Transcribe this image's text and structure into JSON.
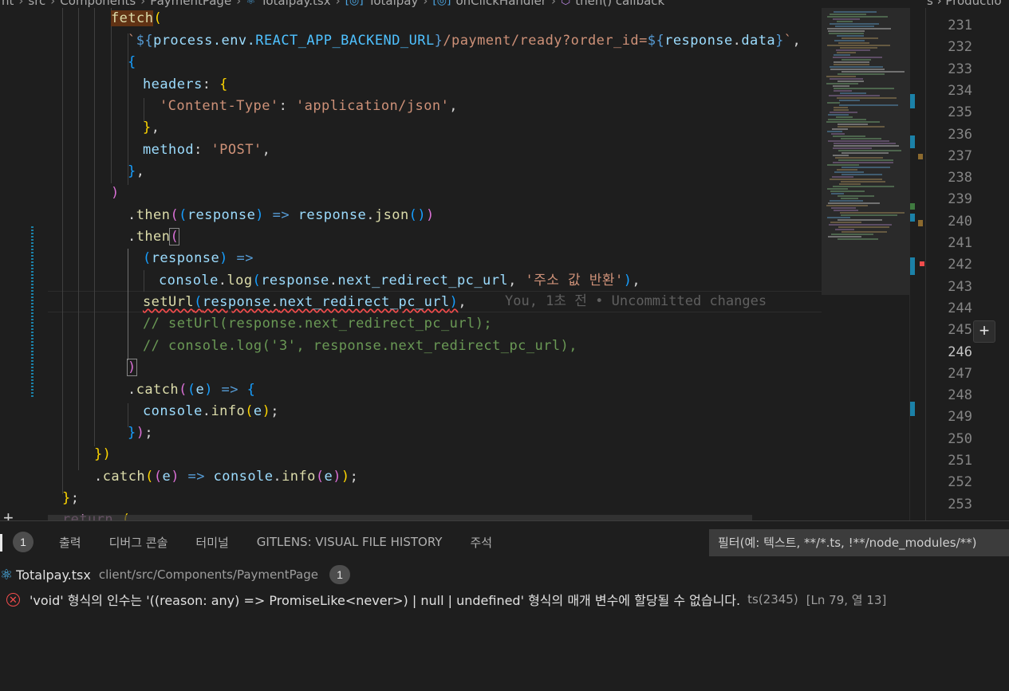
{
  "breadcrumb": {
    "items": [
      "nt",
      "src",
      "Components",
      "PaymentPage",
      "Totalpay.tsx",
      "Totalpay",
      "onClickHandler",
      "then() callback"
    ],
    "right_tab": "s › Productio"
  },
  "editor": {
    "line_numbers": [
      "231",
      "232",
      "233",
      "234",
      "235",
      "236",
      "237",
      "238",
      "239",
      "240",
      "241",
      "242",
      "243",
      "244",
      "245",
      "246",
      "247",
      "248",
      "249",
      "250",
      "251",
      "252",
      "253"
    ],
    "active_line": "246",
    "code": {
      "l1_fetch": "fetch",
      "l2_env": "process.env.",
      "l2_const": "REACT_APP_BACKEND_URL",
      "l2_path": "/payment/ready?order_id=",
      "l2_resp": "response",
      "l2_data": "data",
      "l4_headers": "headers",
      "l5_ct_key": "'Content-Type'",
      "l5_ct_val": "'application/json'",
      "l7_method": "method",
      "l7_post": "'POST'",
      "l10_then": "then",
      "l10_resp": "response",
      "l10_resp2": "response",
      "l10_json": "json",
      "l11_then": "then",
      "l12_resp": "response",
      "l13_console": "console",
      "l13_log": "log",
      "l13_resp": "response",
      "l13_prop": "next_redirect_pc_url",
      "l13_str": "'주소 값 반환'",
      "l14_seturl": "setUrl",
      "l14_resp": "response",
      "l14_prop": "next_redirect_pc_url",
      "l15_comment": "// setUrl(response.next_redirect_pc_url);",
      "l16_comment": "// console.log('3', response.next_redirect_pc_url),",
      "l18_catch": "catch",
      "l18_e": "e",
      "l19_console": "console",
      "l19_info": "info",
      "l19_e": "e",
      "l22_catch": "catch",
      "l22_e": "e",
      "l22_console": "console",
      "l22_info": "info",
      "l22_e2": "e",
      "l24_return": "return"
    },
    "blame": "You, 1초 전 • Uncommitted changes"
  },
  "panel": {
    "tabs": {
      "problems_count": "1",
      "output": "출력",
      "debug_console": "디버그 콘솔",
      "terminal": "터미널",
      "gitlens": "GITLENS: VISUAL FILE HISTORY",
      "comments": "주석"
    },
    "filter_placeholder": "필터(예: 텍스트, **/*.ts, !**/node_modules/**)",
    "file": {
      "name": "Totalpay.tsx",
      "path": "client/src/Components/PaymentPage",
      "count": "1"
    },
    "problem": {
      "message": "'void' 형식의 인수는 '((reason: any) => PromiseLike<never>) | null | undefined' 형식의 매개 변수에 할당될 수 없습니다.",
      "code": "ts(2345)",
      "position": "[Ln 79, 열 13]"
    }
  },
  "colors": {
    "background": "#1e1e1e",
    "error": "#f14c4c",
    "react": "#4fc1ff"
  }
}
